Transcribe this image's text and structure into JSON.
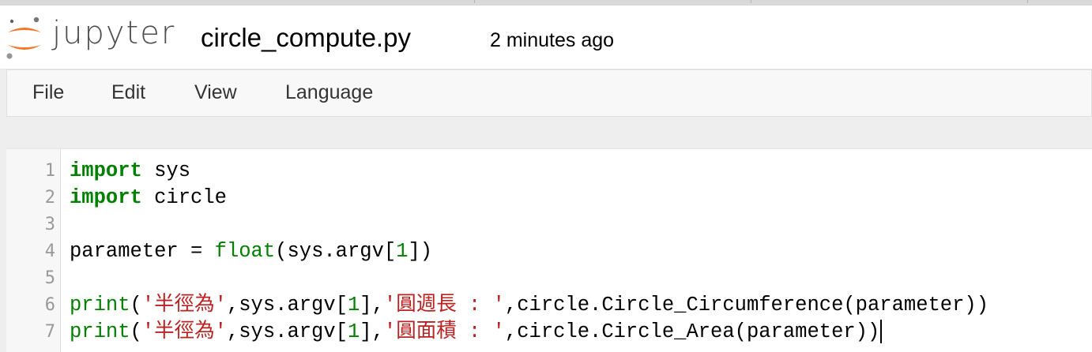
{
  "app": {
    "logo_text": "jupyter"
  },
  "header": {
    "filename": "circle_compute.py",
    "last_saved": "2 minutes ago"
  },
  "menu": {
    "items": [
      "File",
      "Edit",
      "View",
      "Language"
    ]
  },
  "editor": {
    "line_numbers": [
      "1",
      "2",
      "3",
      "4",
      "5",
      "6",
      "7"
    ],
    "lines": [
      {
        "kw": "import",
        "rest": " sys"
      },
      {
        "kw": "import",
        "rest": " circle"
      },
      {
        "text": ""
      },
      {
        "pre": "parameter = ",
        "fn": "float",
        "mid": "(sys.argv[",
        "num": "1",
        "post": "])"
      },
      {
        "text": ""
      },
      {
        "fn": "print",
        "p1": "(",
        "s1": "'半徑為'",
        "p2": ",sys.argv[",
        "num": "1",
        "p3": "],",
        "s2": "'圓週長 : '",
        "p4": ",circle.Circle_Circumference(parameter))"
      },
      {
        "fn": "print",
        "p1": "(",
        "s1": "'半徑為'",
        "p2": ",sys.argv[",
        "num": "1",
        "p3": "],",
        "s2": "'圓面積 : '",
        "p4": ",circle.Circle_Area(parameter))"
      }
    ]
  },
  "colors": {
    "keyword": "#008000",
    "string": "#ba2121",
    "logo_orange": "#f37726"
  }
}
